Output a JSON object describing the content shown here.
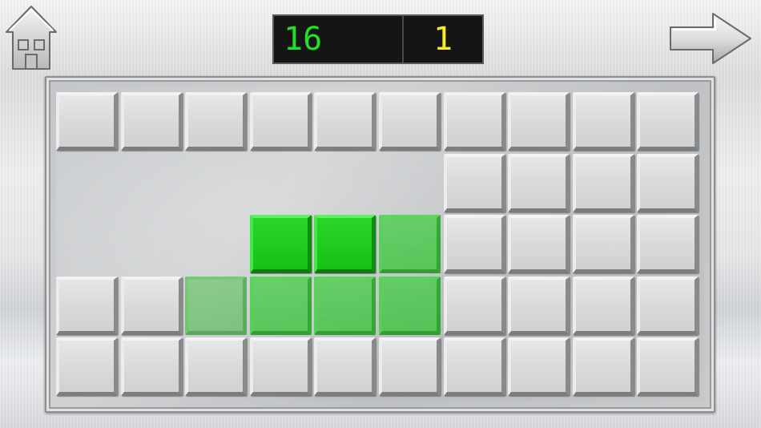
{
  "hud": {
    "moves": "16",
    "level": "1",
    "moves_color": "#22e022",
    "level_color": "#f4ee2a"
  },
  "icons": {
    "home": "house-icon",
    "next": "right-arrow-icon"
  },
  "grid": {
    "columns": 10,
    "rows": 5,
    "cells": [
      [
        "gray",
        "gray",
        "gray",
        "gray",
        "gray",
        "gray",
        "gray",
        "gray",
        "gray",
        "gray"
      ],
      [
        "empty",
        "empty",
        "empty",
        "empty",
        "empty",
        "empty",
        "gray",
        "gray",
        "gray",
        "gray"
      ],
      [
        "empty",
        "empty",
        "empty",
        "green",
        "green",
        "ghost",
        "gray",
        "gray",
        "gray",
        "gray"
      ],
      [
        "gray",
        "gray",
        "ghost-faint",
        "ghost",
        "ghost",
        "ghost",
        "gray",
        "gray",
        "gray",
        "gray"
      ],
      [
        "gray",
        "gray",
        "gray",
        "gray",
        "gray",
        "gray",
        "gray",
        "gray",
        "gray",
        "gray"
      ]
    ]
  },
  "colors": {
    "tile_gray": "#d9dadb",
    "tile_green": "#1fcc1f",
    "board_bg": "#c6c8cb",
    "scoreboard_bg": "#151515"
  }
}
